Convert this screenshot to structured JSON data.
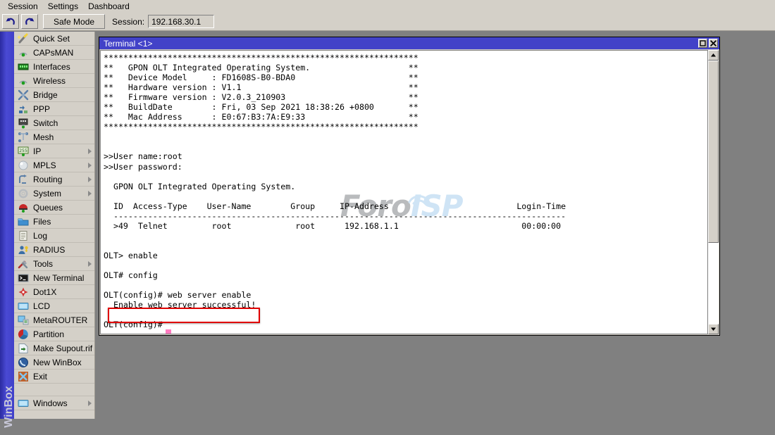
{
  "menubar": {
    "items": [
      {
        "label": "Session",
        "name": "menu-session"
      },
      {
        "label": "Settings",
        "name": "menu-settings"
      },
      {
        "label": "Dashboard",
        "name": "menu-dashboard"
      }
    ]
  },
  "toolbar": {
    "undo_icon": "undo-arrow-icon",
    "redo_icon": "redo-arrow-icon",
    "safe_mode_label": "Safe Mode",
    "session_label": "Session:",
    "session_value": "192.168.30.1"
  },
  "rail": {
    "vertical_label": "WinBox",
    "color": "#4040c8"
  },
  "sidebar": {
    "items": [
      {
        "label": "Quick Set",
        "icon": "magic-wand-icon",
        "submenu": false
      },
      {
        "label": "CAPsMAN",
        "icon": "antenna-icon",
        "submenu": false
      },
      {
        "label": "Interfaces",
        "icon": "ports-icon",
        "submenu": false
      },
      {
        "label": "Wireless",
        "icon": "antenna-icon",
        "submenu": false
      },
      {
        "label": "Bridge",
        "icon": "bridge-icon",
        "submenu": false
      },
      {
        "label": "PPP",
        "icon": "ppp-icon",
        "submenu": false
      },
      {
        "label": "Switch",
        "icon": "switch-icon",
        "submenu": false
      },
      {
        "label": "Mesh",
        "icon": "mesh-icon",
        "submenu": false
      },
      {
        "label": "IP",
        "icon": "ip-255-icon",
        "submenu": true
      },
      {
        "label": "MPLS",
        "icon": "mpls-disc-icon",
        "submenu": true
      },
      {
        "label": "Routing",
        "icon": "routing-icon",
        "submenu": true
      },
      {
        "label": "System",
        "icon": "gear-icon",
        "submenu": true
      },
      {
        "label": "Queues",
        "icon": "queues-icon",
        "submenu": false
      },
      {
        "label": "Files",
        "icon": "folder-icon",
        "submenu": false
      },
      {
        "label": "Log",
        "icon": "log-icon",
        "submenu": false
      },
      {
        "label": "RADIUS",
        "icon": "radius-user-icon",
        "submenu": false
      },
      {
        "label": "Tools",
        "icon": "tools-icon",
        "submenu": true
      },
      {
        "label": "New Terminal",
        "icon": "terminal-icon",
        "submenu": false
      },
      {
        "label": "Dot1X",
        "icon": "dot1x-icon",
        "submenu": false
      },
      {
        "label": "LCD",
        "icon": "lcd-icon",
        "submenu": false
      },
      {
        "label": "MetaROUTER",
        "icon": "metarouter-icon",
        "submenu": false
      },
      {
        "label": "Partition",
        "icon": "partition-icon",
        "submenu": false
      },
      {
        "label": "Make Supout.rif",
        "icon": "supout-icon",
        "submenu": false
      },
      {
        "label": "New WinBox",
        "icon": "winbox-icon",
        "submenu": false
      },
      {
        "label": "Exit",
        "icon": "exit-icon",
        "submenu": false
      },
      {
        "label": "",
        "icon": "",
        "submenu": false
      },
      {
        "label": "Windows",
        "icon": "lcd-icon",
        "submenu": true
      }
    ]
  },
  "terminal": {
    "title": "Terminal <1>",
    "maximize_icon": "maximize-icon",
    "close_icon": "close-icon",
    "banner_device": {
      "header": "GPON OLT Integrated Operating System.",
      "device_model": "FD1608S-B0-BDA0",
      "hardware_version": "V1.1",
      "firmware_version": "V2.0.3_210903",
      "build_date": "Fri, 03 Sep 2021 18:38:26 +0800",
      "mac_address": "E0:67:B3:7A:E9:33"
    },
    "login": {
      "user_name_prompt": ">>User name:root",
      "user_password_prompt": ">>User password:"
    },
    "session_table": {
      "headers": [
        "ID",
        "Access-Type",
        "User-Name",
        "Group",
        "IP-Address",
        "Login-Time"
      ],
      "rows": [
        [
          ">49",
          "Telnet",
          "root",
          "root",
          "192.168.1.1",
          "00:00:00"
        ]
      ]
    },
    "commands": [
      {
        "prompt": "OLT> ",
        "cmd": "enable"
      },
      {
        "prompt": "OLT# ",
        "cmd": "config"
      },
      {
        "prompt": "OLT(config)# ",
        "cmd": "web server enable"
      },
      {
        "prompt": "OLT(config)# ",
        "cmd": ""
      }
    ],
    "highlighted_output": "Enable web server successful!",
    "highlight_color": "#e00000",
    "cursor_color": "#ff7bc0",
    "screen_text": "****************************************************************\n**   GPON OLT Integrated Operating System.                    **\n**   Device Model     : FD1608S-B0-BDA0                       **\n**   Hardware version : V1.1                                  **\n**   Firmware version : V2.0.3_210903                         **\n**   BuildDate        : Fri, 03 Sep 2021 18:38:26 +0800       **\n**   Mac Address      : E0:67:B3:7A:E9:33                     **\n****************************************************************\n\n\n>>User name:root\n>>User password:\n\n  GPON OLT Integrated Operating System.\n\n  ID  Access-Type    User-Name        Group     IP-Address                          Login-Time\n  --------------------------------------------------------------------------------------------\n  >49  Telnet         root             root      192.168.1.1                         00:00:00\n\n\nOLT> enable\n\nOLT# config\n\nOLT(config)# web server enable\n  Enable web server successful!\n\nOLT(config)# "
  },
  "watermark": {
    "text_a": "Foro",
    "text_b": "ISP"
  },
  "scrollbar": {
    "up_icon": "scroll-up-icon",
    "down_icon": "scroll-down-icon"
  }
}
